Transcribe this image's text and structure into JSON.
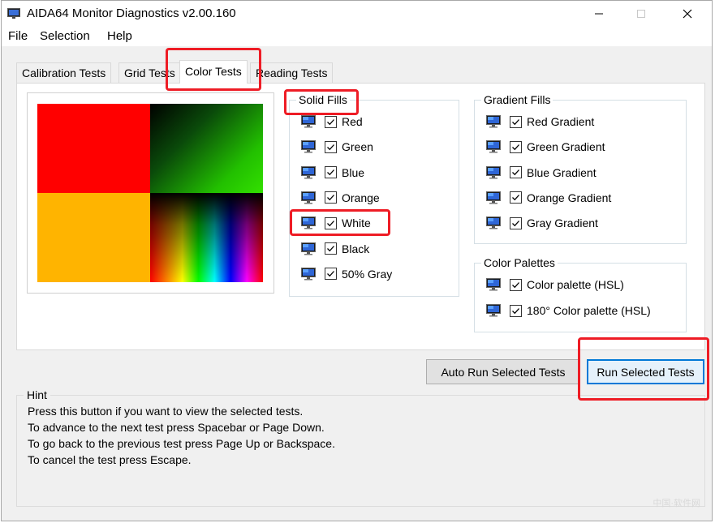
{
  "window": {
    "title": "AIDA64 Monitor Diagnostics v2.00.160",
    "minimize_icon": "minimize-icon",
    "maximize_icon": "maximize-icon",
    "close_icon": "close-icon"
  },
  "menu": [
    {
      "label": "File"
    },
    {
      "label": "Selection"
    },
    {
      "label": "Help"
    }
  ],
  "tabs": [
    {
      "label": "Calibration Tests",
      "active": false
    },
    {
      "label": "Grid Tests",
      "active": false
    },
    {
      "label": "Color Tests",
      "active": true
    },
    {
      "label": "Reading Tests",
      "active": false
    }
  ],
  "preview": {
    "colors": {
      "red": "#ff0000",
      "orange": "#ffb400"
    }
  },
  "solid_fills": {
    "title": "Solid Fills",
    "items": [
      {
        "label": "Red",
        "checked": true
      },
      {
        "label": "Green",
        "checked": true
      },
      {
        "label": "Blue",
        "checked": true
      },
      {
        "label": "Orange",
        "checked": true
      },
      {
        "label": "White",
        "checked": true
      },
      {
        "label": "Black",
        "checked": true
      },
      {
        "label": "50% Gray",
        "checked": true
      }
    ]
  },
  "gradient_fills": {
    "title": "Gradient Fills",
    "items": [
      {
        "label": "Red Gradient",
        "checked": true
      },
      {
        "label": "Green Gradient",
        "checked": true
      },
      {
        "label": "Blue Gradient",
        "checked": true
      },
      {
        "label": "Orange Gradient",
        "checked": true
      },
      {
        "label": "Gray Gradient",
        "checked": true
      }
    ]
  },
  "color_palettes": {
    "title": "Color Palettes",
    "items": [
      {
        "label": "Color palette (HSL)",
        "checked": true
      },
      {
        "label": "180° Color palette (HSL)",
        "checked": true
      }
    ]
  },
  "buttons": {
    "auto_run": "Auto Run Selected Tests",
    "run": "Run Selected Tests"
  },
  "hint": {
    "title": "Hint",
    "lines": [
      "Press this button if you want to view the selected tests.",
      "To advance to the next test press Spacebar or Page Down.",
      "To go back to the previous test press Page Up or Backspace.",
      "To cancel the test press Escape."
    ]
  },
  "watermark": "中国·软件网",
  "colors": {
    "annotation": "#ee1c25",
    "default_button_border": "#0078d7"
  }
}
